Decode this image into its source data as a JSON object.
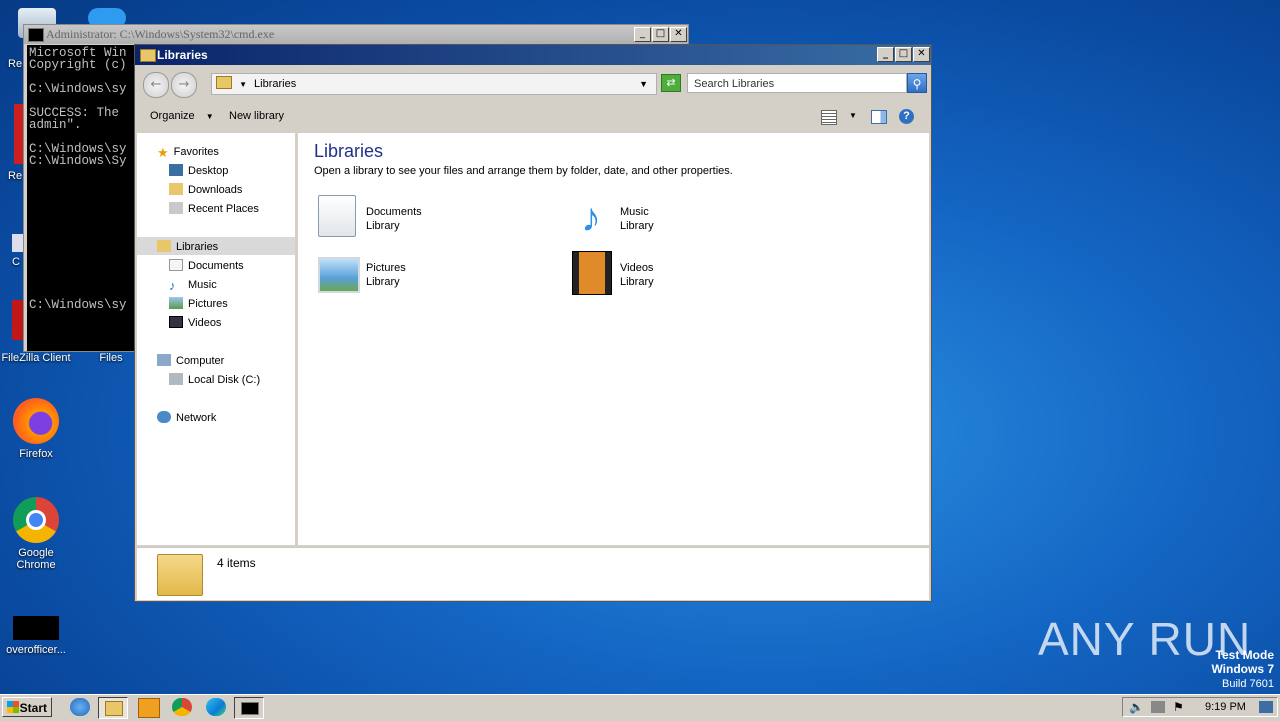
{
  "desktop": {
    "icons": [
      {
        "label": "FileZilla Client"
      },
      {
        "label": "Files"
      },
      {
        "label": "Firefox"
      },
      {
        "label": "Google Chrome"
      },
      {
        "label": "overofficer..."
      }
    ]
  },
  "cmd": {
    "title": "Administrator: C:\\Windows\\System32\\cmd.exe",
    "lines": "Microsoft Win\nCopyright (c)\n\nC:\\Windows\\sy\n\nSUCCESS: The \nadmin\".\n\nC:\\Windows\\sy\nC:\\Windows\\Sy\n\n\n\n\n\n\n\n\n\n\n\nC:\\Windows\\sy"
  },
  "explorer": {
    "title": "Libraries",
    "address": "Libraries",
    "search_placeholder": "Search Libraries",
    "toolbar": {
      "organize": "Organize",
      "new_library": "New library"
    },
    "nav": {
      "favorites": "Favorites",
      "desktop": "Desktop",
      "downloads": "Downloads",
      "recent": "Recent Places",
      "libraries": "Libraries",
      "documents": "Documents",
      "music": "Music",
      "pictures": "Pictures",
      "videos": "Videos",
      "computer": "Computer",
      "local_disk": "Local Disk (C:)",
      "network": "Network"
    },
    "heading": "Libraries",
    "subtitle": "Open a library to see your files and arrange them by folder, date, and other properties.",
    "libraries": [
      {
        "name": "Documents",
        "type": "Library"
      },
      {
        "name": "Music",
        "type": "Library"
      },
      {
        "name": "Pictures",
        "type": "Library"
      },
      {
        "name": "Videos",
        "type": "Library"
      }
    ],
    "status": "4 items"
  },
  "taskbar": {
    "start": "Start",
    "clock": "9:19 PM"
  },
  "watermark": {
    "brand": "ANY RUN",
    "mode": "Test Mode",
    "os": "Windows 7",
    "build": "Build 7601"
  }
}
